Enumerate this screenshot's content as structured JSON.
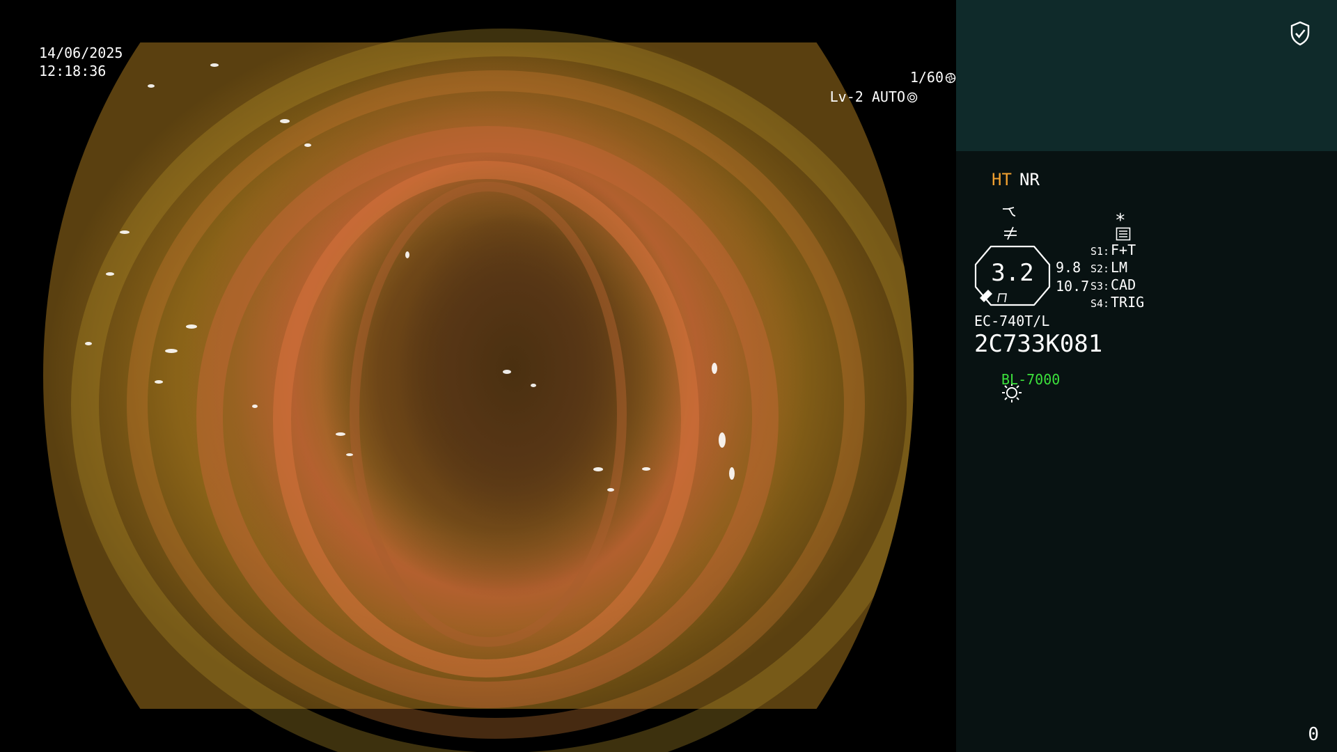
{
  "overlay": {
    "date": "14/06/2025",
    "time": "12:18:36",
    "shutter": "1/60",
    "exposure": "Lv-2 AUTO"
  },
  "panel": {
    "enhancement": {
      "ht": "HT",
      "nr": "NR"
    },
    "zoom": "3.2",
    "values": [
      "9.8",
      "10.7"
    ],
    "switches": [
      {
        "key": "S1:",
        "value": "F+T"
      },
      {
        "key": "S2:",
        "value": "LM"
      },
      {
        "key": "S3:",
        "value": "CAD"
      },
      {
        "key": "S4:",
        "value": "TRIG"
      }
    ],
    "star": "*",
    "scope_model": "EC-740T/L",
    "scope_serial": "2C733K081",
    "light_source": "BL-7000",
    "counter": "0"
  },
  "colors": {
    "panel_bg": "#081212",
    "panel_top_bg": "#0f2a2a",
    "ht_color": "#f0a030",
    "light_source_color": "#3ce03c"
  },
  "icons": [
    "shield-check-icon",
    "curve-icon",
    "not-equal-icon",
    "menu-list-icon",
    "aperture-icon",
    "sun-icon"
  ]
}
